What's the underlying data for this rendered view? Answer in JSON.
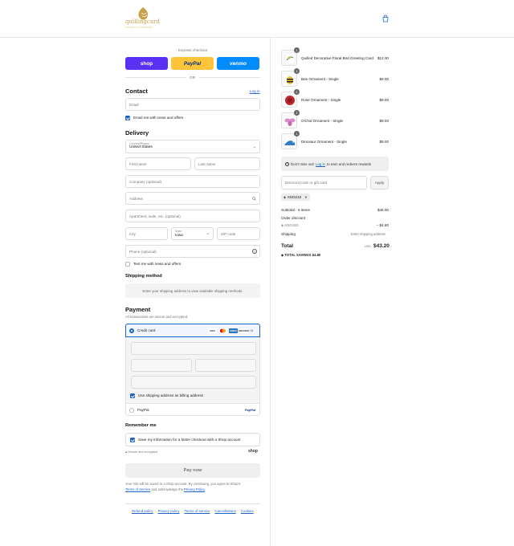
{
  "header": {
    "logo_text": "quillingcard",
    "logo_tagline": "THE GIFT OF QUILLED ART",
    "bag_icon": "shopping-bag-icon"
  },
  "express": {
    "title": "Express checkout",
    "shop_label": "shop",
    "paypal_label": "PayPal",
    "venmo_label": "venmo",
    "or_label": "OR"
  },
  "contact": {
    "title": "Contact",
    "login_label": "Log in",
    "email_placeholder": "Email",
    "news_label": "Email me with news and offers"
  },
  "delivery": {
    "title": "Delivery",
    "country_label": "Country/Region",
    "country_value": "United States",
    "first_name": "First name",
    "last_name": "Last name",
    "company": "Company (optional)",
    "address": "Address",
    "apartment": "Apartment, suite, etc. (optional)",
    "city": "City",
    "state_label": "State",
    "state_value": "Iowa",
    "zip": "ZIP code",
    "phone": "Phone (optional)",
    "text_offers": "Text me with news and offers"
  },
  "shipping": {
    "title": "Shipping method",
    "placeholder": "Enter your shipping address to view available shipping methods."
  },
  "payment": {
    "title": "Payment",
    "subtitle": "All transactions are secure and encrypted.",
    "credit_card_label": "Credit card",
    "cards": [
      "VISA",
      "MC",
      "AMEX",
      "DISCOVER"
    ],
    "more_cards": "+5",
    "billing_label": "Use shipping address as billing address",
    "paypal_label": "PayPal",
    "paypal_logo": "PayPal"
  },
  "remember": {
    "title": "Remember me",
    "save_label": "Save my information for a faster checkout with a Shop account",
    "secure_label": "Secure and encrypted",
    "shop_logo": "shop"
  },
  "pay_button": "Pay now",
  "legal": {
    "line1": "Your info will be saved to a Shop account. By continuing, you agree to Shop's",
    "terms": "Terms of Service",
    "and_ack": "and acknowledge the",
    "privacy": "Privacy Policy",
    "period": "."
  },
  "footer": {
    "links": [
      "Refund policy",
      "Privacy policy",
      "Terms of service",
      "Cancellations",
      "Cookies"
    ]
  },
  "order": {
    "items": [
      {
        "name": "Quilled Decorative Floral Bird Greeting Card",
        "price": "$12.00",
        "qty": "1"
      },
      {
        "name": "Bee Ornament - Single",
        "price": "$9.00",
        "qty": "1"
      },
      {
        "name": "Rose Ornament - Single",
        "price": "$9.00",
        "qty": "1"
      },
      {
        "name": "Orchid Ornament - Single",
        "price": "$9.00",
        "qty": "1"
      },
      {
        "name": "Dinosaur Ornament - Single",
        "price": "$9.00",
        "qty": "1"
      }
    ],
    "notice_pre": "Don't miss out!",
    "notice_link": "Log in",
    "notice_post": "to earn and redeem rewards",
    "discount_placeholder": "Discount code or gift card",
    "apply_label": "Apply",
    "discount_tag": "KNOJI10",
    "subtotal_label": "Subtotal · 5 items",
    "subtotal_value": "$48.00",
    "order_discount_label": "Order discount",
    "discount_code": "KNOJI10",
    "discount_value": "– $4.80",
    "shipping_label": "Shipping",
    "shipping_value": "Enter shipping address",
    "total_label": "Total",
    "currency": "USD",
    "total_value": "$43.20",
    "savings_label": "TOTAL SAVINGS",
    "savings_value": "$4.80"
  },
  "colors": {
    "accent": "#1f62c8",
    "shop": "#5a31f4",
    "paypal": "#ffc439",
    "venmo": "#008cff"
  }
}
